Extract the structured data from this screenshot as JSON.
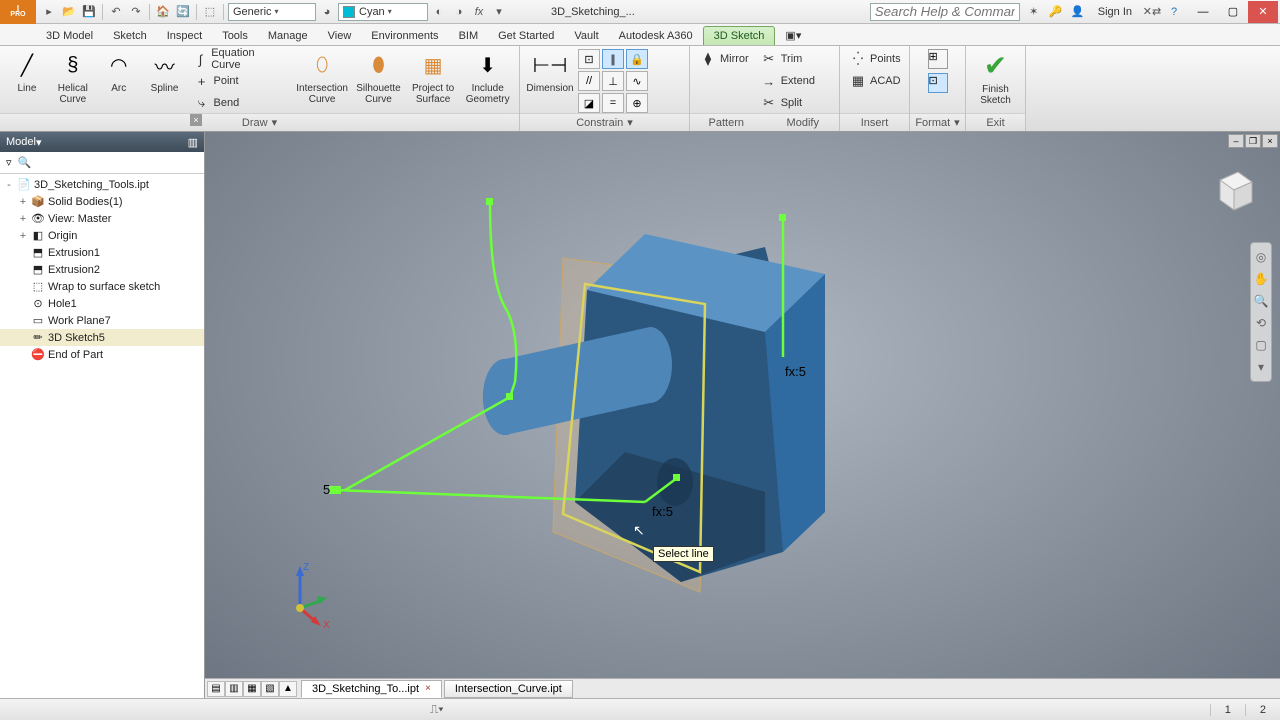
{
  "app": {
    "logo_text": "I\nPRO"
  },
  "qat": {
    "material_label": "Generic",
    "color_label": "Cyan",
    "color_hex": "#00bcd4",
    "doc_title": "3D_Sketching_...",
    "search_placeholder": "Search Help & Commands...",
    "signin": "Sign In"
  },
  "tabs": [
    "3D Model",
    "Sketch",
    "Inspect",
    "Tools",
    "Manage",
    "View",
    "Environments",
    "BIM",
    "Get Started",
    "Vault",
    "Autodesk A360",
    "3D Sketch"
  ],
  "active_tab": "3D Sketch",
  "ribbon": {
    "draw": {
      "title": "Draw",
      "big": [
        {
          "name": "line",
          "label": "Line"
        },
        {
          "name": "helical-curve",
          "label": "Helical\nCurve"
        },
        {
          "name": "arc",
          "label": "Arc"
        },
        {
          "name": "spline",
          "label": "Spline"
        }
      ],
      "list": [
        {
          "name": "equation-curve",
          "label": "Equation Curve"
        },
        {
          "name": "point",
          "label": "Point"
        },
        {
          "name": "bend",
          "label": "Bend"
        }
      ],
      "big2": [
        {
          "name": "intersection-curve",
          "label": "Intersection\nCurve"
        },
        {
          "name": "silhouette-curve",
          "label": "Silhouette\nCurve"
        },
        {
          "name": "project-to-surface",
          "label": "Project to\nSurface"
        },
        {
          "name": "include-geometry",
          "label": "Include\nGeometry"
        }
      ]
    },
    "constrain": {
      "title": "Constrain",
      "dimension": "Dimension"
    },
    "pattern": {
      "title": "Pattern"
    },
    "modify": {
      "title": "Modify",
      "items": [
        {
          "name": "mirror",
          "label": "Mirror"
        },
        {
          "name": "trim",
          "label": "Trim"
        },
        {
          "name": "extend",
          "label": "Extend"
        },
        {
          "name": "split",
          "label": "Split"
        }
      ]
    },
    "insert": {
      "title": "Insert",
      "items": [
        {
          "name": "points",
          "label": "Points"
        },
        {
          "name": "acad",
          "label": "ACAD"
        }
      ]
    },
    "format": {
      "title": "Format"
    },
    "exit": {
      "title": "Exit",
      "finish": "Finish\nSketch"
    }
  },
  "browser": {
    "header": "Model",
    "nodes": [
      {
        "depth": 0,
        "tw": "-",
        "icon": "📄",
        "label": "3D_Sketching_Tools.ipt"
      },
      {
        "depth": 1,
        "tw": "+",
        "icon": "📦",
        "label": "Solid Bodies(1)"
      },
      {
        "depth": 1,
        "tw": "+",
        "icon": "👁",
        "label": "View: Master"
      },
      {
        "depth": 1,
        "tw": "+",
        "icon": "◧",
        "label": "Origin"
      },
      {
        "depth": 1,
        "tw": "",
        "icon": "⬒",
        "label": "Extrusion1"
      },
      {
        "depth": 1,
        "tw": "",
        "icon": "⬒",
        "label": "Extrusion2"
      },
      {
        "depth": 1,
        "tw": "",
        "icon": "⬚",
        "label": "Wrap to surface sketch"
      },
      {
        "depth": 1,
        "tw": "",
        "icon": "⊙",
        "label": "Hole1"
      },
      {
        "depth": 1,
        "tw": "",
        "icon": "▭",
        "label": "Work Plane7"
      },
      {
        "depth": 1,
        "tw": "",
        "icon": "✏",
        "label": "3D Sketch5",
        "sel": true
      },
      {
        "depth": 1,
        "tw": "",
        "icon": "⛔",
        "label": "End of Part"
      }
    ]
  },
  "canvas": {
    "dim1": "fx:5",
    "dim2": "fx:5",
    "dim3": "5",
    "tooltip": "Select line",
    "axes": {
      "x": "X",
      "y": "Y",
      "z": "Z"
    }
  },
  "doc_tabs": [
    {
      "label": "3D_Sketching_To...ipt",
      "active": true,
      "closable": true
    },
    {
      "label": "Intersection_Curve.ipt",
      "active": false,
      "closable": false
    }
  ],
  "status": {
    "left": "",
    "n1": "1",
    "n2": "2"
  }
}
